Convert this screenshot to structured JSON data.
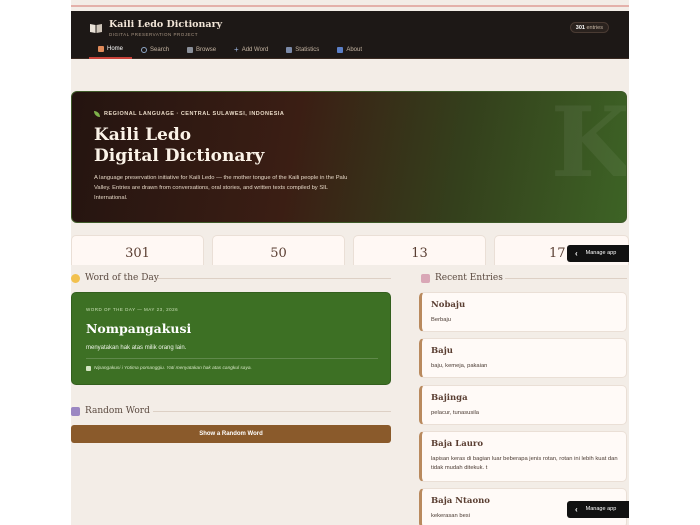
{
  "app": {
    "title": "Kaili Ledo Dictionary",
    "subtitle": "DIGITAL PRESERVATION PROJECT",
    "entries_count": "301",
    "entries_label": "entries"
  },
  "nav": {
    "items": [
      {
        "label": "Home",
        "icon": "home-icon"
      },
      {
        "label": "Search",
        "icon": "search-icon"
      },
      {
        "label": "Browse",
        "icon": "browse-icon"
      },
      {
        "label": "Add Word",
        "icon": "plus-icon"
      },
      {
        "label": "Statistics",
        "icon": "chart-icon"
      },
      {
        "label": "About",
        "icon": "info-icon"
      }
    ]
  },
  "hero": {
    "tag": "REGIONAL LANGUAGE · CENTRAL SULAWESI, INDONESIA",
    "title_line1": "Kaili Ledo",
    "title_line2": "Digital Dictionary",
    "watermark": "K",
    "description": "A language preservation initiative for Kaili Ledo — the mother tongue of the Kaili people in the Palu Valley. Entries are drawn from conversations, oral stories, and written texts compiled by SIL International."
  },
  "stats": [
    "301",
    "50",
    "13",
    "17"
  ],
  "manage_app": "Manage app",
  "word_of_day": {
    "section_title": "Word of the Day",
    "label": "WORD OF THE DAY — MAY 23, 2026",
    "word": "Nompangakusi",
    "definition": "menyatakan hak atas milik orang lain.",
    "example": "Nipangakusi i Yotima pomanggiu. Yati menyatakan hak atas cangkul saya."
  },
  "random_word": {
    "section_title": "Random Word",
    "button_label": "Show a Random Word"
  },
  "recent": {
    "section_title": "Recent Entries",
    "entries": [
      {
        "word": "Nobaju",
        "definition": "Berbaju"
      },
      {
        "word": "Baju",
        "definition": "baju, kemeja, pakaian"
      },
      {
        "word": "Bajinga",
        "definition": "pelacur, tunasusila"
      },
      {
        "word": "Baja Lauro",
        "definition": "lapisan keras di bagian luar beberapa jenis rotan, rotan ini lebih kuat dan tidak mudah ditekuk. t"
      },
      {
        "word": "Baja Ntaono",
        "definition": "kekerasan besi"
      }
    ]
  },
  "colors": {
    "accent_red": "#c9423a",
    "wotd_green": "#3d7024",
    "button_brown": "#8a5a2b",
    "header_dark": "#1d1816"
  }
}
